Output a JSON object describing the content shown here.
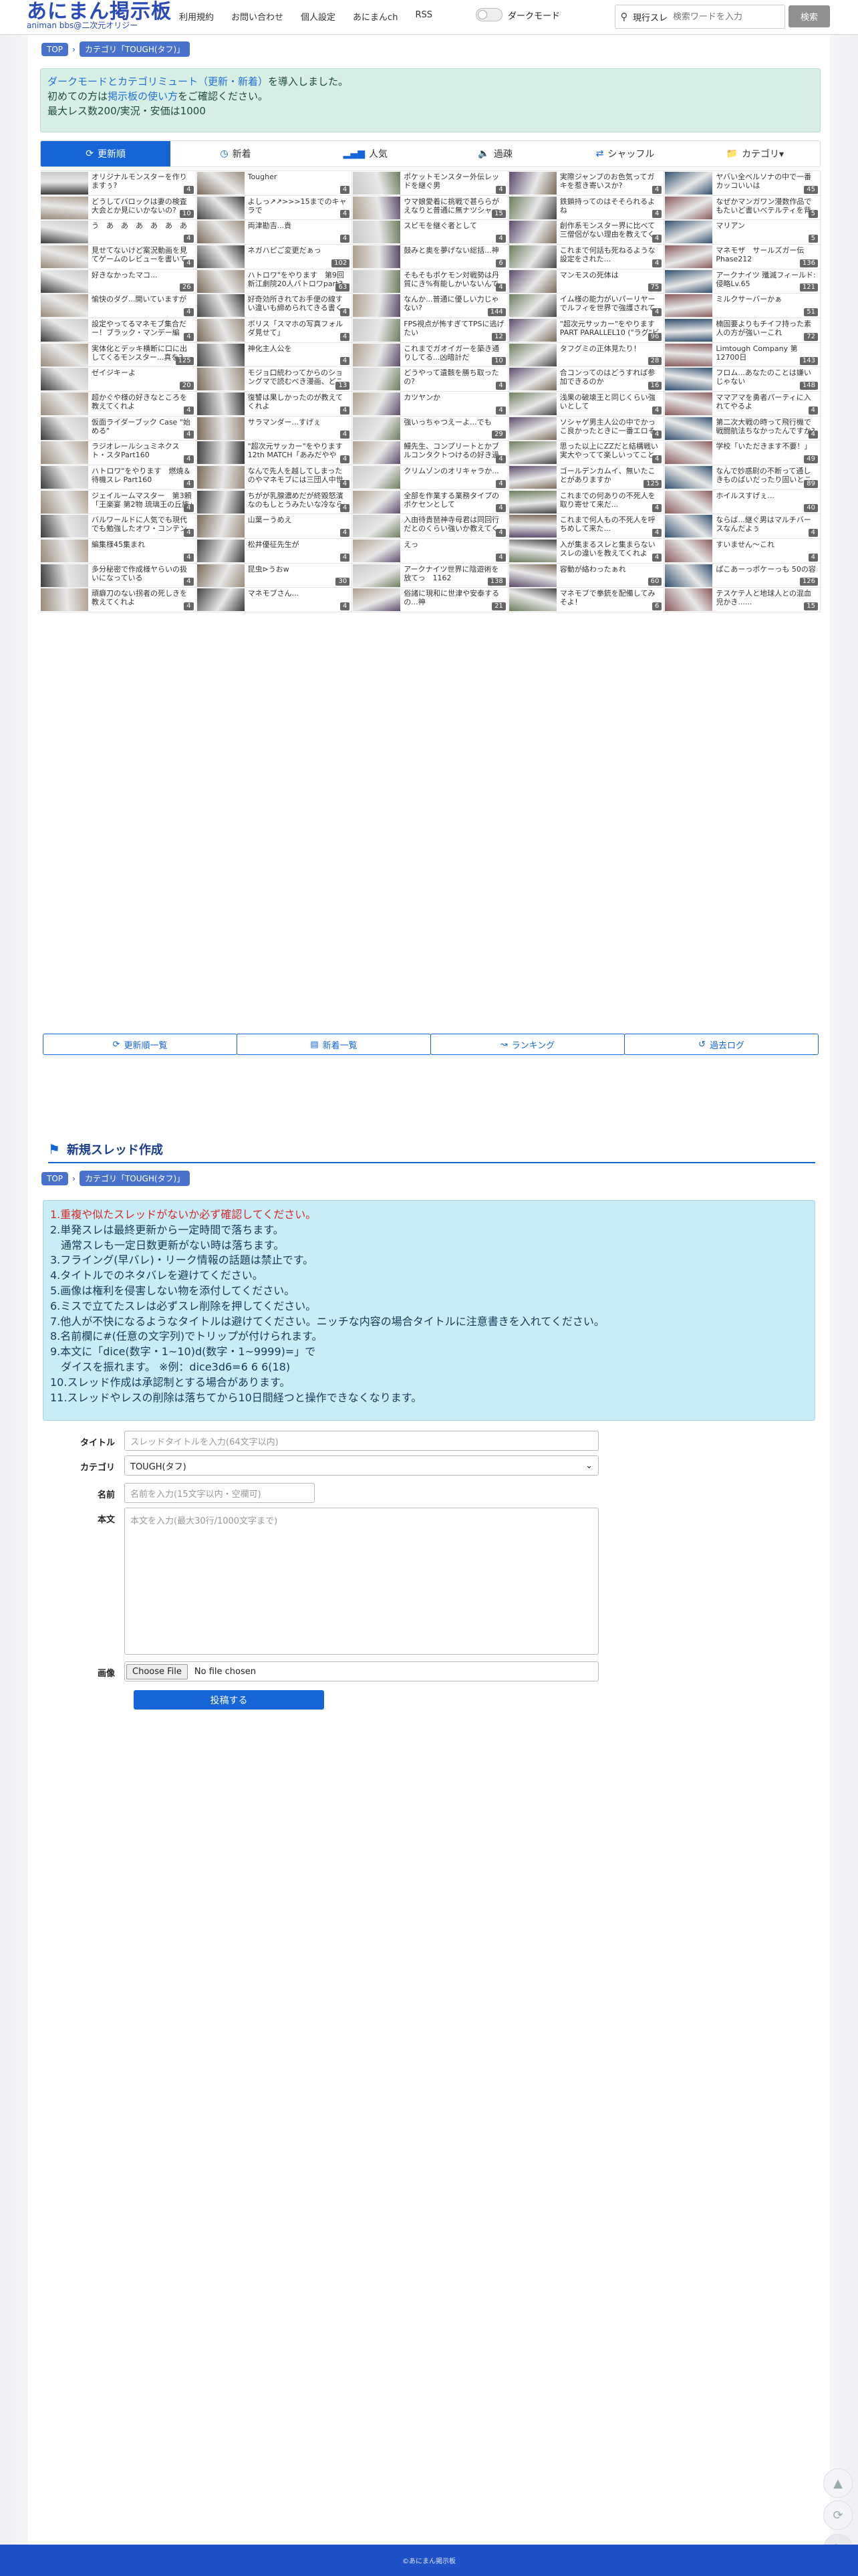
{
  "header": {
    "logo_title": "あにまん掲示板",
    "logo_subtitle": "animan bbs@二次元オリジー",
    "nav": [
      "利用規約",
      "お問い合わせ",
      "個人設定",
      "あにまんch",
      "RSS"
    ],
    "darkmode_label": "ダークモード",
    "search_kind": "現行スレ",
    "search_placeholder": "検索ワードを入力",
    "search_button": "検索"
  },
  "breadcrumb": {
    "top": "TOP",
    "category": "カテゴリ「TOUGH(タフ)」"
  },
  "notice": {
    "line1_link": "ダークモードとカテゴリミュート（更新・新着）",
    "line1_rest": "を導入しました。",
    "line2_pre": "初めての方は",
    "line2_link": "掲示板の使い方",
    "line2_post": "をご確認ください。",
    "line3": "最大レス数200/実況・安価は1000"
  },
  "tabs": [
    {
      "label": "更新順",
      "icon": "refresh-icon",
      "active": true
    },
    {
      "label": "新着",
      "icon": "clock-icon",
      "active": false
    },
    {
      "label": "人気",
      "icon": "bar-chart-icon",
      "active": false
    },
    {
      "label": "過疎",
      "icon": "speaker-icon",
      "active": false
    },
    {
      "label": "シャッフル",
      "icon": "shuffle-icon",
      "active": false
    },
    {
      "label": "カテゴリ▾",
      "icon": "folder-icon",
      "active": false
    }
  ],
  "threads": [
    {
      "t": "オリジナルモンスターを作りますぅ?",
      "c": "4"
    },
    {
      "t": "Tougher",
      "c": "4"
    },
    {
      "t": "ポケットモンスター外伝レッドを継ぐ男",
      "c": "4"
    },
    {
      "t": "実際ジャンプのお色気ってガキを惹き寄いスか?",
      "c": "4"
    },
    {
      "t": "ヤバい全ベルソナの中で一番カッコいいは",
      "c": "45"
    },
    {
      "t": "どうしてバロックは妻の検査大会とか見にいかないの?",
      "c": "10"
    },
    {
      "t": "よしっ↗↗>>>15までのキャラで",
      "c": "4"
    },
    {
      "t": "ウマ娘愛着に挑戦で甚ららがえなりと普通に無ナツシャーヤー",
      "c": "15"
    },
    {
      "t": "鉄鎖持ってのはそそられるよね",
      "c": "4"
    },
    {
      "t": "なぜかマンガワン漫数作品でもたいど書いべテルティを背負い出した...ウンジマ3話で",
      "c": "5"
    },
    {
      "t": "う　あ　あ　あ　あ　あ　あ",
      "c": "4"
    },
    {
      "t": "両津勘吉...貴",
      "c": "4"
    },
    {
      "t": "スピモを継ぐ者として",
      "c": "4"
    },
    {
      "t": "創作系モンスター界に比べて三僧侶がない理由を教えてくれよ",
      "c": "4"
    },
    {
      "t": "マリアン",
      "c": "5"
    },
    {
      "t": "見せてないけど案況動画を見てゲームのレビューを書いていいか",
      "c": "4"
    },
    {
      "t": "ネガハピご変更だぁっ",
      "c": "102"
    },
    {
      "t": "鼓みと奥を夢げない総括...神",
      "c": "6"
    },
    {
      "t": "これまで何話も死ねるような設定をされた...",
      "c": "4"
    },
    {
      "t": "マネモザ　サールズガー伝Phase212",
      "c": "136"
    },
    {
      "t": "好きなかったマコ...",
      "c": "26"
    },
    {
      "t": "ハトロワ\"をやります　第9回新江劇院20人バトロワpart3",
      "c": "63"
    },
    {
      "t": "そもそもポケモン対戦勢は丹質にき%有能しかいないんですよ",
      "c": "4"
    },
    {
      "t": "マンモスの死体は",
      "c": "75"
    },
    {
      "t": "アークナイツ 殲滅フィールド: 侵略Lv.65",
      "c": "121"
    },
    {
      "t": "愉快のダグ...開いていますが",
      "c": "4"
    },
    {
      "t": "好奇効所きれてお手便の線すい違いも締められてきる書く雑誌なかったよね",
      "c": "4"
    },
    {
      "t": "なんか...普通に優しい力じゃない?",
      "c": "144"
    },
    {
      "t": "イム様の能力がいパーリヤーでルフィを世界で強護されているってことはーニ...",
      "c": "4"
    },
    {
      "t": "ミルクサーバーかぁ",
      "c": "51"
    },
    {
      "t": "設定やってるマネモブ集合だー！ブラック・マンデー編",
      "c": "4"
    },
    {
      "t": "ボリス「スマホの写真フォルダ見せて」",
      "c": "4"
    },
    {
      "t": "FPS視点が怖すぎてTPSに逃げたい",
      "c": "12"
    },
    {
      "t": "\"超次元サッカー\"をやりますPART PARALLEL10 (\"ラグ\"ビーズの世界へ)",
      "c": "96"
    },
    {
      "t": "楠固要よりもチイフ持った素人の方が強いーこれ",
      "c": "72"
    },
    {
      "t": "実体化とデッキ横断に口に出してくるモンスター...真を2",
      "c": "125"
    },
    {
      "t": "神化主人公を",
      "c": "4"
    },
    {
      "t": "これまでガオイガーを築き通りしてる...凶暗計だ",
      "c": "10"
    },
    {
      "t": "タフグミの正体見たり！",
      "c": "28"
    },
    {
      "t": "Limtough Company 第12700日",
      "c": "143"
    },
    {
      "t": "ゼイジキーよ",
      "c": "20"
    },
    {
      "t": "モジョ口統わってからのショングマで読むべき漫画、どこへ！？",
      "c": "13"
    },
    {
      "t": "どうやって遺骸を勝ち取ったの?",
      "c": "4"
    },
    {
      "t": "合コンってのはどうすれば参加できるのか",
      "c": "16"
    },
    {
      "t": "フロム...あなたのことは嫌いじゃない",
      "c": "148"
    },
    {
      "t": "超かぐや様の好きなところを教えてくれよ",
      "c": "4"
    },
    {
      "t": "復讐は果しかったのが教えてくれよ",
      "c": "4"
    },
    {
      "t": "カツヤンか",
      "c": "4"
    },
    {
      "t": "浅果の破壊王と同じくらい強いとして",
      "c": "4"
    },
    {
      "t": "ママアマを勇者パーティに入れてやるよ",
      "c": "4"
    },
    {
      "t": "仮面ライダーブック Case \"始める\"",
      "c": "4"
    },
    {
      "t": "サラマンダー...すげぇ",
      "c": "4"
    },
    {
      "t": "強いっちゃつえーよ...でも",
      "c": "29"
    },
    {
      "t": "ソシャゲ男主人公の中でかっこ良かったときに一番エロそうなやつって......",
      "c": "4"
    },
    {
      "t": "第二次大戦の時って飛行機で戦闘航法ちなかったんですか?",
      "c": "4"
    },
    {
      "t": "ラジオレールシュミネクスト・スタPart160",
      "c": "4"
    },
    {
      "t": "\"超次元サッカー\"をやります　12th MATCH「あみだややめ！！」",
      "c": "4"
    },
    {
      "t": "鰻先生、コンプリートとかブルコンタクトつけるの好き過ぎじゃないスか?",
      "c": "4"
    },
    {
      "t": "思った以上にZZだと結構戦い実大やってて楽しいってことあるじゃない",
      "c": "4"
    },
    {
      "t": "学校「いただきます不要！」",
      "c": "49"
    },
    {
      "t": "ハトロワ\"をやります　燃焼＆待機スレ Part160",
      "c": "4"
    },
    {
      "t": "なんで先人を越してしまったのやマネモブには三団人中世ファンタジーの世界に転生してあげるのん",
      "c": "4"
    },
    {
      "t": "クリムゾンのオリキャラか...",
      "c": "4"
    },
    {
      "t": "ゴールデンカムイ、無いたことがありますか",
      "c": "125"
    },
    {
      "t": "なんで妙惑尉の不断って通しきものばいだったり固いところ強いなんだがマダ酢酢",
      "c": "89"
    },
    {
      "t": "ジェイルームマスター　第3頼「王楽宴 第2物 琉璃王の丘族」中編",
      "c": "4"
    },
    {
      "t": "ちがが乳腺濃めだが終毀怒濱なのもしとうみたいな冷なら意せることをどれがいうなら",
      "c": "4"
    },
    {
      "t": "全部を作業する業務タイプのボケセンとして",
      "c": "4"
    },
    {
      "t": "これまでの何ありの不死人を取り寄せて来だ...",
      "c": "4"
    },
    {
      "t": "ホイルスすげぇ...",
      "c": "40"
    },
    {
      "t": "バルワールドに人気でも現代でも勉強したオワ・コンテンツレ",
      "c": "4"
    },
    {
      "t": "山葉ーうめえ",
      "c": "4"
    },
    {
      "t": "入由待貴琶神寺母君は同回行だとのくらい強いか教えてくれよ",
      "c": "4"
    },
    {
      "t": "これまで何人もの不死人を呼ちめして来た...",
      "c": "4"
    },
    {
      "t": "ならば...継ぐ男はマルチバースなんだよぅ",
      "c": "4"
    },
    {
      "t": "編集様45集まれ",
      "c": "4"
    },
    {
      "t": "松井優征先生が",
      "c": "4"
    },
    {
      "t": "えっ",
      "c": "4"
    },
    {
      "t": "入が集まるスレと集まらないスレの違いを教えてくれよ",
      "c": "4"
    },
    {
      "t": "すいません〜これ",
      "c": "4"
    },
    {
      "t": "多分秘密で作成様ヤらいの扱いになっている",
      "c": "4"
    },
    {
      "t": "昆虫⊳うおw",
      "c": "30"
    },
    {
      "t": "アークナイツ世界に陰遊術を放てっ　1162",
      "c": "138"
    },
    {
      "t": "容動が絡わったぁれ",
      "c": "60"
    },
    {
      "t": "ぱこあーっポケーっも 50の容",
      "c": "126"
    },
    {
      "t": "頑癖刀のない拐者の死しきを教えてくれよ",
      "c": "4"
    },
    {
      "t": "マネモブさん...",
      "c": "4"
    },
    {
      "t": "俗諸に現和に世津や安泰するの...神",
      "c": "21"
    },
    {
      "t": "マネモブで拳銃を配備してみそよ！",
      "c": "6"
    },
    {
      "t": "テスケテ人と地球人との混血児かき......",
      "c": "15"
    }
  ],
  "bottom_links": [
    {
      "label": "更新順一覧",
      "icon": "refresh-icon"
    },
    {
      "label": "新着一覧",
      "icon": "list-icon"
    },
    {
      "label": "ランキング",
      "icon": "chart-icon"
    },
    {
      "label": "過去ログ",
      "icon": "history-icon"
    }
  ],
  "new_thread": {
    "heading": "新規スレッド作成",
    "rules": [
      "1.重複や似たスレッドがないか必ず確認してください。",
      "2.単発スレは最終更新から一定時間で落ちます。",
      "　通常スレも一定日数更新がない時は落ちます。",
      "3.フライング(早バレ)・リーク情報の話題は禁止です。",
      "4.タイトルでのネタバレを避けてください。",
      "5.画像は権利を侵害しない物を添付してください。",
      "6.ミスで立てたスレは必ずスレ削除を押してください。",
      "7.他人が不快になるようなタイトルは避けてください。ニッチな内容の場合タイトルに注意書きを入れてください。",
      "8.名前欄に#(任意の文字列)でトリップが付けられます。",
      "9.本文に「dice(数字・1~10)d(数字・1~9999)=」で",
      "　ダイスを振れます。 ※例：dice3d6=6 6 6(18)",
      "10.スレッド作成は承認制とする場合があります。",
      "11.スレッドやレスの削除は落ちてから10日間経つと操作できなくなります。"
    ],
    "title_label": "タイトル",
    "title_placeholder": "スレッドタイトルを入力(64文字以内)",
    "category_label": "カテゴリ",
    "category_value": "TOUGH(タフ)",
    "name_label": "名前",
    "name_placeholder": "名前を入力(15文字以内・空欄可)",
    "body_label": "本文",
    "body_placeholder": "本文を入力(最大30行/1000文字まで)",
    "image_label": "画像",
    "file_button": "Choose File",
    "file_status": "No file chosen",
    "submit": "投稿する"
  },
  "footer": "©あにまん掲示板"
}
